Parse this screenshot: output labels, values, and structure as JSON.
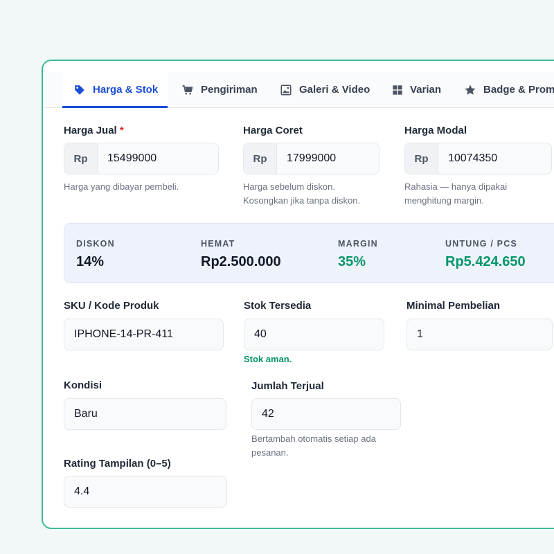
{
  "tabs": [
    {
      "label": "Harga & Stok",
      "icon": "tag-icon",
      "active": true
    },
    {
      "label": "Pengiriman",
      "icon": "cart-icon",
      "active": false
    },
    {
      "label": "Galeri & Video",
      "icon": "image-icon",
      "active": false
    },
    {
      "label": "Varian",
      "icon": "grid-icon",
      "active": false
    },
    {
      "label": "Badge & Promo",
      "icon": "star-icon",
      "active": false
    }
  ],
  "pricing": {
    "harga_jual": {
      "label": "Harga Jual",
      "required_mark": "*",
      "prefix": "Rp",
      "value": "15499000",
      "help": "Harga yang dibayar pembeli."
    },
    "harga_coret": {
      "label": "Harga Coret",
      "prefix": "Rp",
      "value": "17999000",
      "help_line1": "Harga sebelum diskon.",
      "help_line2": "Kosongkan jika tanpa diskon."
    },
    "harga_modal": {
      "label": "Harga Modal",
      "prefix": "Rp",
      "value": "10074350",
      "help_line1": "Rahasia — hanya dipakai",
      "help_line2": "menghitung margin."
    }
  },
  "summary": {
    "diskon": {
      "label": "DISKON",
      "value": "14%"
    },
    "hemat": {
      "label": "HEMAT",
      "value": "Rp2.500.000"
    },
    "margin": {
      "label": "MARGIN",
      "value": "35%"
    },
    "untung": {
      "label": "UNTUNG / PCS",
      "value": "Rp5.424.650"
    }
  },
  "inventory": {
    "sku": {
      "label": "SKU / Kode Produk",
      "value": "IPHONE-14-PR-411"
    },
    "stok": {
      "label": "Stok Tersedia",
      "value": "40",
      "status": "Stok aman."
    },
    "min_beli": {
      "label": "Minimal Pembelian",
      "value": "1"
    },
    "kondisi": {
      "label": "Kondisi",
      "value": "Baru"
    },
    "terjual": {
      "label": "Jumlah Terjual",
      "value": "42",
      "help_line1": "Bertambah otomatis setiap ada",
      "help_line2": "pesanan."
    },
    "rating": {
      "label": "Rating Tampilan (0–5)",
      "value": "4.4"
    }
  },
  "colors": {
    "accent": "#1d4ed8",
    "success": "#059669",
    "card_border": "#3fb99a",
    "required": "#dc2626"
  }
}
